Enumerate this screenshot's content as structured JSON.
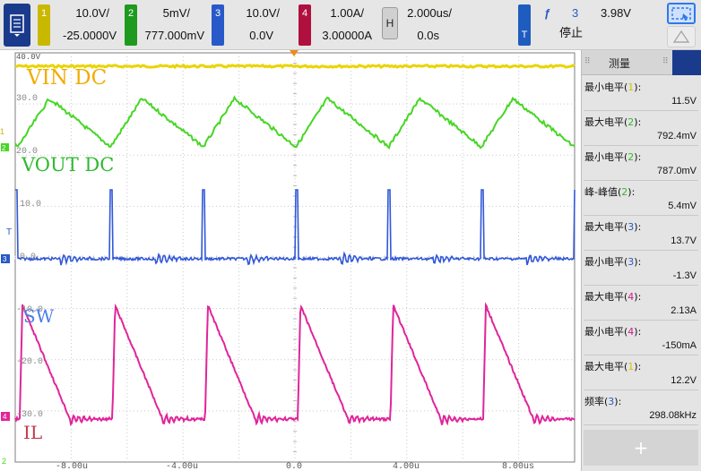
{
  "toolbar": {
    "menu_icon": "document-menu-icon",
    "channels": [
      {
        "num": "1",
        "color": "#c9b800",
        "scale": "10.0V/",
        "offset": "-25.0000V"
      },
      {
        "num": "2",
        "color": "#1e9b1e",
        "scale": "5mV/",
        "offset": "777.000mV"
      },
      {
        "num": "3",
        "color": "#2859c8",
        "scale": "10.0V/",
        "offset": "0.0V"
      },
      {
        "num": "4",
        "color": "#b0103e",
        "scale": "1.00A/",
        "offset": "3.00000A"
      }
    ],
    "horizontal": {
      "badge": "H",
      "timebase": "2.000us/",
      "position": "0.0s"
    },
    "trigger": {
      "badge": "T",
      "edge_symbol": "ƒ",
      "source": "3",
      "level": "3.98V",
      "status": "停止"
    }
  },
  "screen": {
    "top_scale_label": "40.0V",
    "grid_labels": [
      "30.0",
      "20.0",
      "10.0",
      "0.0",
      "-10.0",
      "-20.0",
      "-30.0"
    ],
    "time_labels": [
      "-8.00u",
      "-4.00u",
      "0.0",
      "4.00u",
      "8.00us"
    ],
    "trace_labels": [
      "VIN DC",
      "VOUT DC",
      "SW",
      "IL"
    ],
    "trace_colors": {
      "vin": "#ead400",
      "vout": "#46d624",
      "sw": "#3158d8",
      "il": "#e0259a"
    },
    "left_markers": [
      "1",
      "2",
      "T",
      "3",
      "4",
      "2"
    ]
  },
  "measurements": {
    "title": "测量",
    "items": [
      {
        "label": "最小电平",
        "ch": "1",
        "ch_color": "#d4c200",
        "value": "11.5V"
      },
      {
        "label": "最大电平",
        "ch": "2",
        "ch_color": "#34b82a",
        "value": "792.4mV"
      },
      {
        "label": "最小电平",
        "ch": "2",
        "ch_color": "#34b82a",
        "value": "787.0mV"
      },
      {
        "label": "峰-峰值",
        "ch": "2",
        "ch_color": "#34b82a",
        "value": "5.4mV"
      },
      {
        "label": "最大电平",
        "ch": "3",
        "ch_color": "#2859c8",
        "value": "13.7V"
      },
      {
        "label": "最小电平",
        "ch": "3",
        "ch_color": "#2859c8",
        "value": "-1.3V"
      },
      {
        "label": "最大电平",
        "ch": "4",
        "ch_color": "#d01a8a",
        "value": "2.13A"
      },
      {
        "label": "最小电平",
        "ch": "4",
        "ch_color": "#d01a8a",
        "value": "-150mA"
      },
      {
        "label": "最大电平",
        "ch": "1",
        "ch_color": "#d4c200",
        "value": "12.2V"
      },
      {
        "label": "频率",
        "ch": "3",
        "ch_color": "#2859c8",
        "value": "298.08kHz"
      }
    ],
    "add_label": "+"
  }
}
